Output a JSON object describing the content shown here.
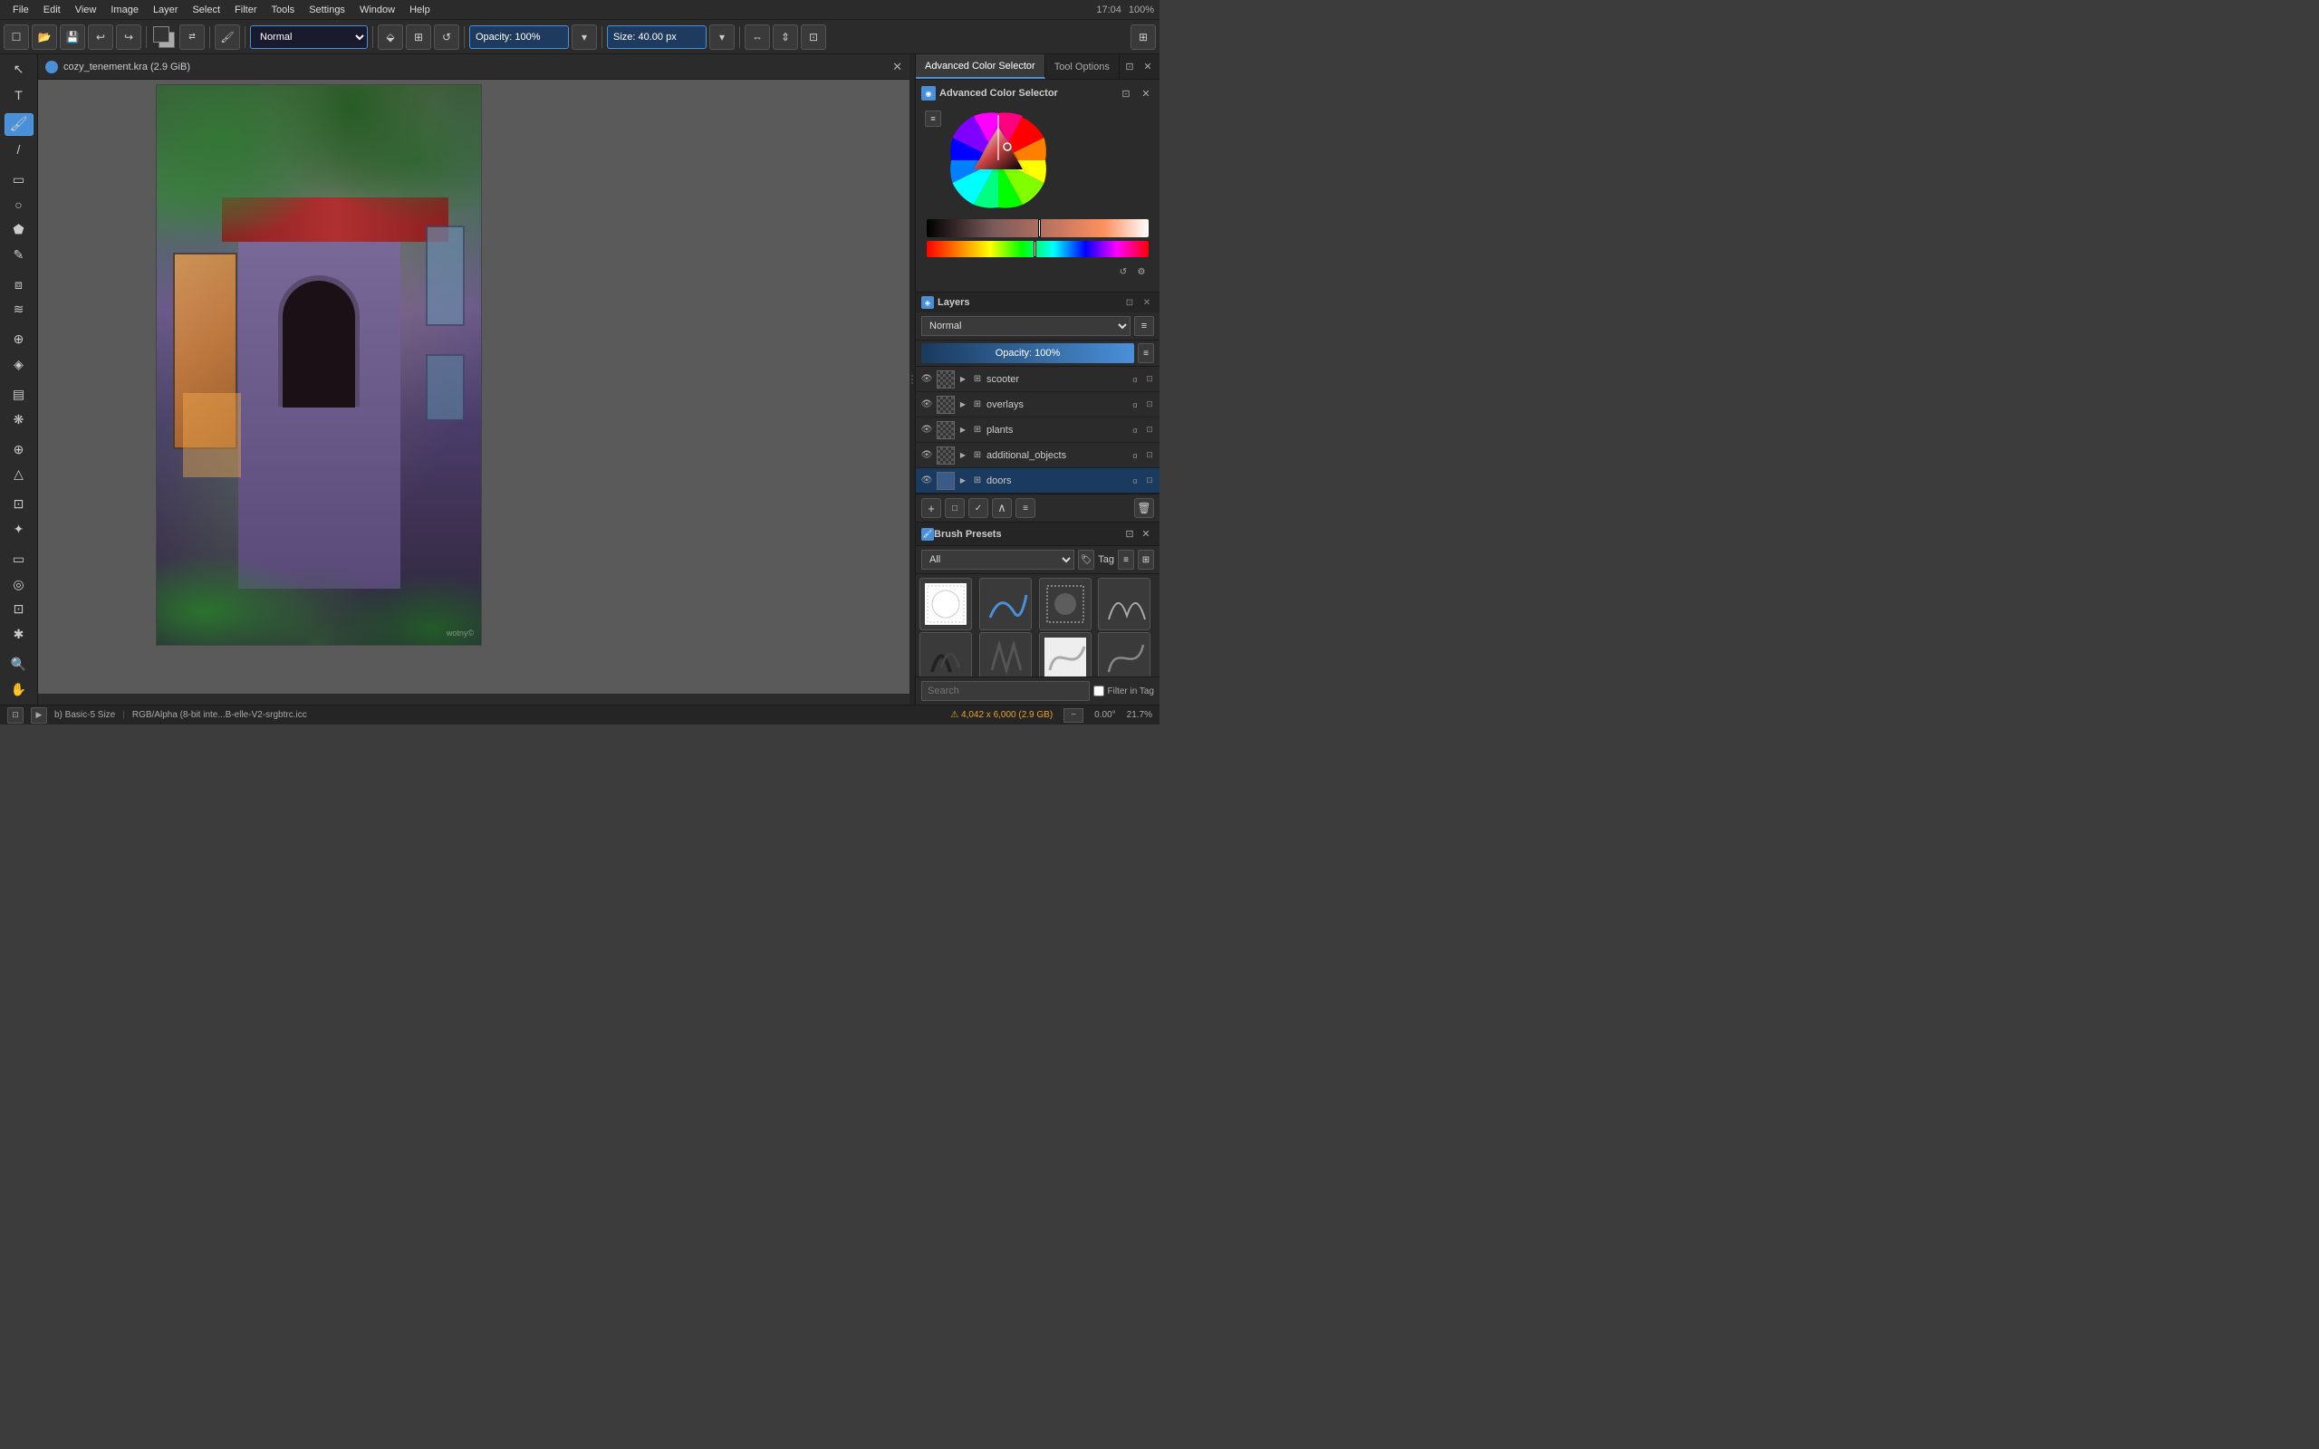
{
  "app": {
    "time": "17:04",
    "battery": "100%"
  },
  "menubar": {
    "items": [
      "File",
      "Edit",
      "View",
      "Image",
      "Layer",
      "Select",
      "Filter",
      "Tools",
      "Settings",
      "Window",
      "Help"
    ]
  },
  "toolbar": {
    "blend_mode": "Normal",
    "opacity_label": "Opacity: 100%",
    "size_label": "Size: 40.00 px",
    "brush_preset": "b) Basic-5 Size"
  },
  "canvas": {
    "tab_title": "cozy_tenement.kra (2.9 GiB)",
    "document_info": "RGB/Alpha (8-bit inte...B-elle-V2-srgbtrc.icc",
    "dimensions": "4,042 x 6,000 (2.9 GB)",
    "zoom": "21.7%",
    "rotation": "0.00°",
    "watermark": "wotny©"
  },
  "color_selector": {
    "title": "Advanced Color Selector",
    "tab_label": "Advanced Color Selector"
  },
  "tool_options": {
    "title": "Tool Options"
  },
  "layers": {
    "title": "Layers",
    "blend_mode": "Normal",
    "opacity": "Opacity: 100%",
    "items": [
      {
        "name": "scooter",
        "visible": true,
        "type": "group",
        "active": false
      },
      {
        "name": "overlays",
        "visible": true,
        "type": "group",
        "active": false
      },
      {
        "name": "plants",
        "visible": true,
        "type": "group",
        "active": false
      },
      {
        "name": "additional_objects",
        "visible": true,
        "type": "group",
        "active": false
      },
      {
        "name": "doors",
        "visible": true,
        "type": "group",
        "active": true
      }
    ],
    "footer_buttons": [
      "+",
      "□",
      "✓",
      "∧",
      "≡",
      "🗑"
    ]
  },
  "brush_presets": {
    "title": "Brush Presets",
    "filter": "All",
    "tag": "Tag",
    "search_placeholder": "Search",
    "filter_in_tag": "Filter in Tag"
  },
  "statusbar": {
    "brush_size": "b) Basic-5 Size",
    "color_profile": "RGB/Alpha (8-bit inte...B-elle-V2-srgbtrc.icc",
    "dimensions": "4,042 x 6,000 (2.9 GB)",
    "rotation": "0.00°",
    "zoom": "21.7%"
  }
}
